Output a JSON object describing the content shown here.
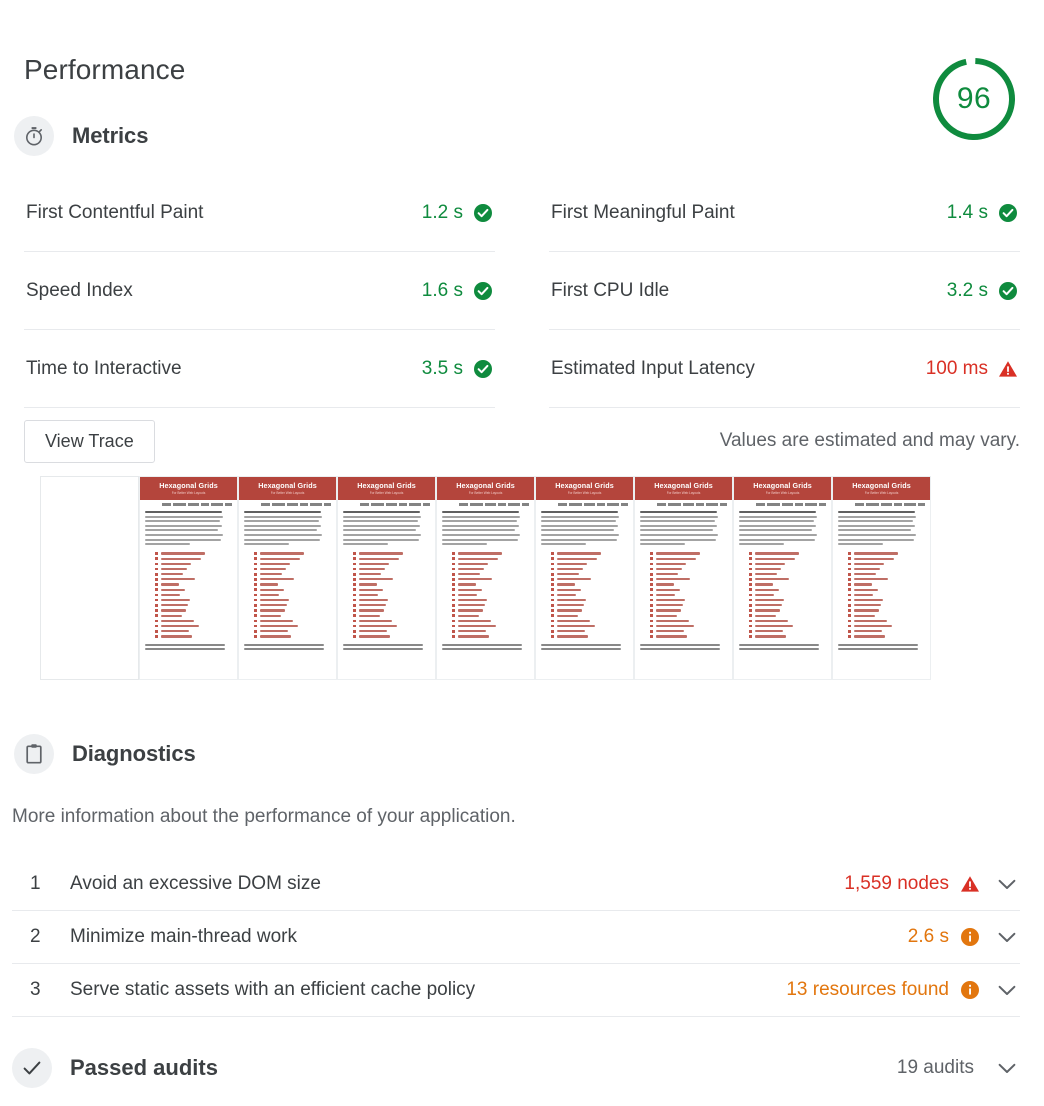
{
  "report": {
    "category_title": "Performance",
    "score": "96",
    "score_value": 96,
    "score_color": "#0f8b3e"
  },
  "metrics_section": {
    "title": "Metrics",
    "icon": "stopwatch-icon",
    "rows": [
      {
        "name": "First Contentful Paint",
        "value": "1.2 s",
        "status": "pass",
        "badge": "check-circle-icon"
      },
      {
        "name": "First Meaningful Paint",
        "value": "1.4 s",
        "status": "pass",
        "badge": "check-circle-icon"
      },
      {
        "name": "Speed Index",
        "value": "1.6 s",
        "status": "pass",
        "badge": "check-circle-icon"
      },
      {
        "name": "First CPU Idle",
        "value": "3.2 s",
        "status": "pass",
        "badge": "check-circle-icon"
      },
      {
        "name": "Time to Interactive",
        "value": "3.5 s",
        "status": "pass",
        "badge": "check-circle-icon"
      },
      {
        "name": "Estimated Input Latency",
        "value": "100 ms",
        "status": "average",
        "badge": "warning-triangle-icon"
      }
    ],
    "view_trace_label": "View Trace",
    "estimate_note": "Values are estimated and may vary."
  },
  "filmstrip": {
    "frame_count": 9,
    "blank_first": true,
    "page_title": "Hexagonal Grids",
    "page_subtitle": "For Better Web Layouts"
  },
  "diagnostics_section": {
    "title": "Diagnostics",
    "icon": "clipboard-icon",
    "description": "More information about the performance of your application.",
    "audits": [
      {
        "index": "1",
        "title": "Avoid an excessive DOM size",
        "value": "1,559 nodes",
        "status": "red",
        "badge": "warning-triangle-icon",
        "chevron": "chevron-down-icon"
      },
      {
        "index": "2",
        "title": "Minimize main-thread work",
        "value": "2.6 s",
        "status": "orange",
        "badge": "info-circle-icon",
        "chevron": "chevron-down-icon"
      },
      {
        "index": "3",
        "title": "Serve static assets with an efficient cache policy",
        "value": "13 resources found",
        "status": "orange",
        "badge": "info-circle-icon",
        "chevron": "chevron-down-icon"
      }
    ]
  },
  "passed_audits": {
    "title": "Passed audits",
    "icon": "checkmark-icon",
    "count_label": "19 audits",
    "chevron": "chevron-down-icon"
  },
  "colors": {
    "pass_green": "#0f8b3e",
    "fail_red": "#d93025",
    "average_orange": "#e2760e",
    "text_primary": "#3c4043",
    "text_secondary": "#5f6368",
    "divider": "#e8eaed",
    "filmstrip_band": "#b4453c"
  }
}
